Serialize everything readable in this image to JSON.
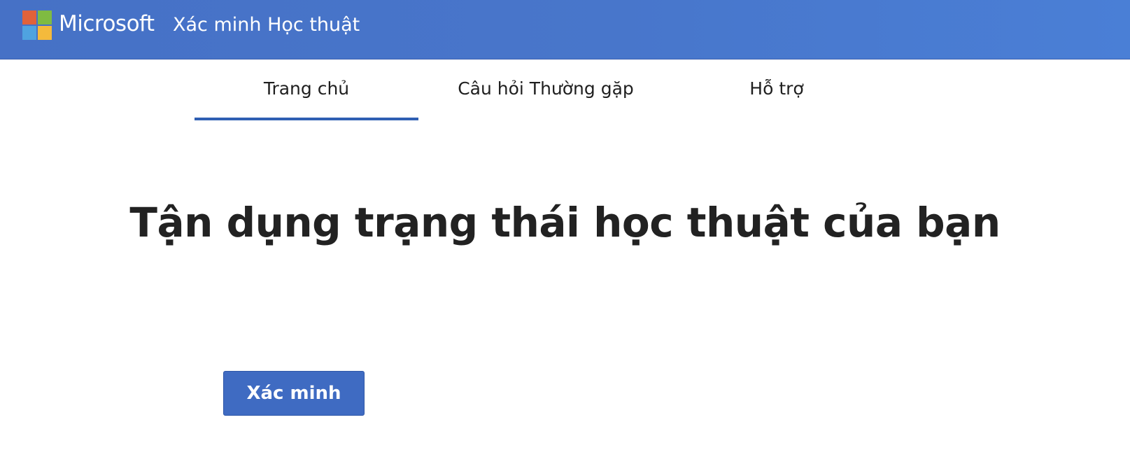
{
  "header": {
    "brand": "Microsoft",
    "app_title": "Xác minh Học thuật",
    "logo_colors": [
      "#e0623a",
      "#7fbb42",
      "#4fa3e0",
      "#f4ba3c"
    ],
    "bar_color": "#4876cb"
  },
  "nav": {
    "tabs": [
      {
        "label": "Trang chủ",
        "active": true
      },
      {
        "label": "Câu hỏi Thường gặp",
        "active": false
      },
      {
        "label": "Hỗ trợ",
        "active": false
      }
    ]
  },
  "main": {
    "headline": "Tận dụng trạng thái học thuật của bạn",
    "verify_button": "Xác minh",
    "accent": "#3f6bc2"
  }
}
